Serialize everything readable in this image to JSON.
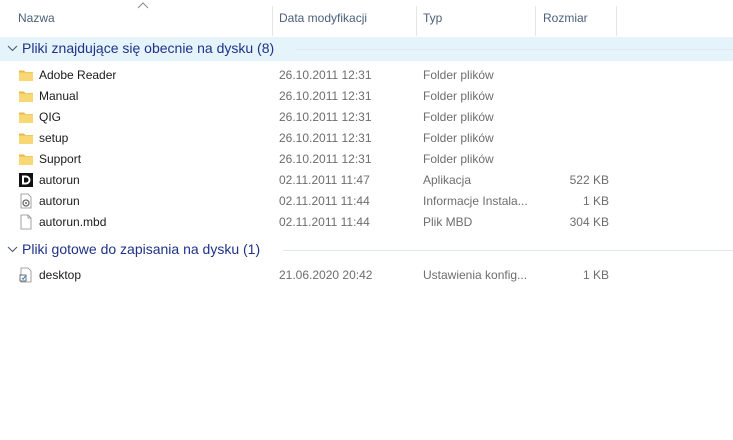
{
  "columns": {
    "name": "Nazwa",
    "date": "Data modyfikacji",
    "type": "Typ",
    "size": "Rozmiar"
  },
  "groups": [
    {
      "title": "Pliki znajdujące się obecnie na dysku (8)",
      "items": [
        {
          "name": "Adobe Reader",
          "date": "26.10.2011 12:31",
          "type": "Folder plików",
          "size": "",
          "icon": "folder-icon"
        },
        {
          "name": "Manual",
          "date": "26.10.2011 12:31",
          "type": "Folder plików",
          "size": "",
          "icon": "folder-icon"
        },
        {
          "name": "QIG",
          "date": "26.10.2011 12:31",
          "type": "Folder plików",
          "size": "",
          "icon": "folder-icon"
        },
        {
          "name": "setup",
          "date": "26.10.2011 12:31",
          "type": "Folder plików",
          "size": "",
          "icon": "folder-icon"
        },
        {
          "name": "Support",
          "date": "26.10.2011 12:31",
          "type": "Folder plików",
          "size": "",
          "icon": "folder-icon"
        },
        {
          "name": "autorun",
          "date": "02.11.2011 11:47",
          "type": "Aplikacja",
          "size": "522 KB",
          "icon": "dlink-app-icon"
        },
        {
          "name": "autorun",
          "date": "02.11.2011 11:44",
          "type": "Informacje Instala...",
          "size": "1 KB",
          "icon": "setup-info-icon"
        },
        {
          "name": "autorun.mbd",
          "date": "02.11.2011 11:44",
          "type": "Plik MBD",
          "size": "304 KB",
          "icon": "blank-file-icon"
        }
      ]
    },
    {
      "title": "Pliki gotowe do zapisania na dysku (1)",
      "items": [
        {
          "name": "desktop",
          "date": "21.06.2020 20:42",
          "type": "Ustawienia konfig...",
          "size": "1 KB",
          "icon": "config-file-icon"
        }
      ]
    }
  ],
  "colors": {
    "group_title": "#1e3287",
    "header_text": "#4c607a",
    "selected_group_bg": "#e5f3fb",
    "folder": "#f8d775"
  }
}
